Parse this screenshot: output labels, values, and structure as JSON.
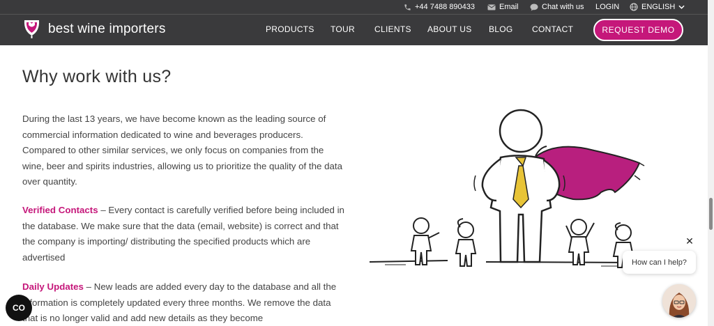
{
  "topbar": {
    "phone": "+44 7488 890433",
    "email": "Email",
    "chat": "Chat with us",
    "login": "LOGIN",
    "language": "ENGLISH"
  },
  "brand": {
    "name": "best wine importers"
  },
  "nav": {
    "items": [
      "PRODUCTS",
      "TOUR",
      "CLIENTS",
      "ABOUT US",
      "BLOG",
      "CONTACT"
    ],
    "cta": "REQUEST DEMO"
  },
  "main": {
    "title": "Why work with us?",
    "intro": "During the last 13 years, we have become known as the leading source of commercial information dedicated to wine and beverages producers. Compared to other similar services, we only focus on companies from the wine, beer and spirits industries, allowing us to prioritize the quality of the data over quantity.",
    "features": [
      {
        "heading": "Verified Contacts",
        "text": " – Every contact is carefully verified before being included in the database. We make sure that the data (email, website) is correct and that the company is importing/ distributing the specified products which are advertised"
      },
      {
        "heading": "Daily Updates",
        "text": " – New leads are added every day to the database and all the information is completely updated every three months. We remove the data that is no longer valid and add new details as they become"
      }
    ]
  },
  "chat_widget": {
    "prompt": "How can I help?",
    "close": "✕"
  },
  "cookie_button": {
    "label": "CO"
  },
  "colors": {
    "accent": "#c5177a",
    "header_bg": "#3a3a3c",
    "cape": "#b81f7e"
  }
}
